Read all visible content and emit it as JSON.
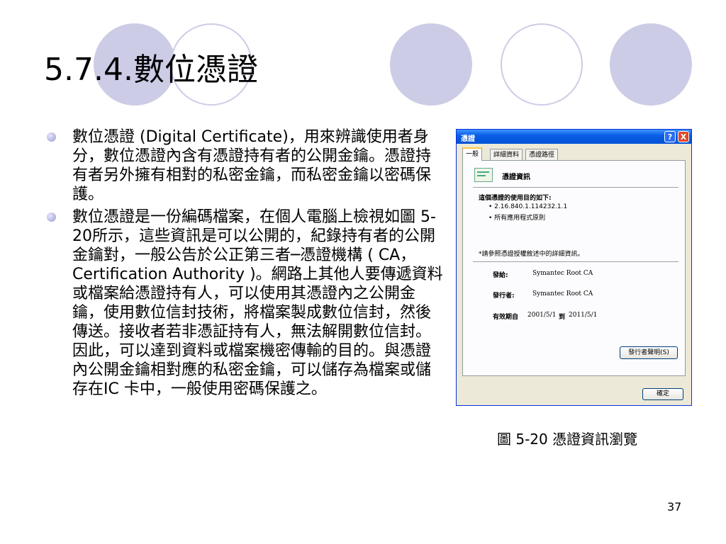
{
  "title": "5.7.4.數位憑證",
  "bullets": [
    "數位憑證 (Digital Certificate)，用來辨識使用者身分，數位憑證內含有憑證持有者的公開金鑰。憑證持有者另外擁有相對的私密金鑰，而私密金鑰以密碼保護。",
    "數位憑證是一份編碼檔案，在個人電腦上檢視如圖 5-20所示，這些資訊是可以公開的，紀錄持有者的公開金鑰對，一般公告於公正第三者─憑證機構 ( CA，Certification Authority )。網路上其他人要傳遞資料或檔案給憑證持有人，可以使用其憑證內之公開金鑰，使用數位信封技術，將檔案製成數位信封，然後傳送。接收者若非憑証持有人，無法解開數位信封。因此，可以達到資料或檔案機密傳輸的目的。與憑證內公開金鑰相對應的私密金鑰，可以儲存為檔案或儲存在IC 卡中，一般使用密碼保護之。"
  ],
  "dialog": {
    "title": "憑證",
    "help_label": "?",
    "close_label": "X",
    "tabs": [
      "一般",
      "詳細資料",
      "憑證路徑"
    ],
    "heading": "憑證資訊",
    "purpose_title": "這個憑證的使用目的如下:",
    "purposes": [
      "• 2.16.840.1.114232.1.1",
      "• 所有應用程式原則"
    ],
    "note": "*請參照憑證授權敘述中的詳細資訊。",
    "issued_to_label": "發給:",
    "issued_to_value": "Symantec Root CA",
    "issued_by_label": "發行者:",
    "issued_by_value": "Symantec Root CA",
    "valid_label": "有效期自",
    "valid_from": "2001/5/1",
    "valid_to_label": "到",
    "valid_to": "2011/5/1",
    "issuer_statement_button": "發行者聲明(S)",
    "ok_button": "確定"
  },
  "caption": "圖 5-20 憑證資訊瀏覽",
  "page_number": "37",
  "colors": {
    "circle": "#cccce6",
    "titlebar": "#0a5fe6"
  }
}
